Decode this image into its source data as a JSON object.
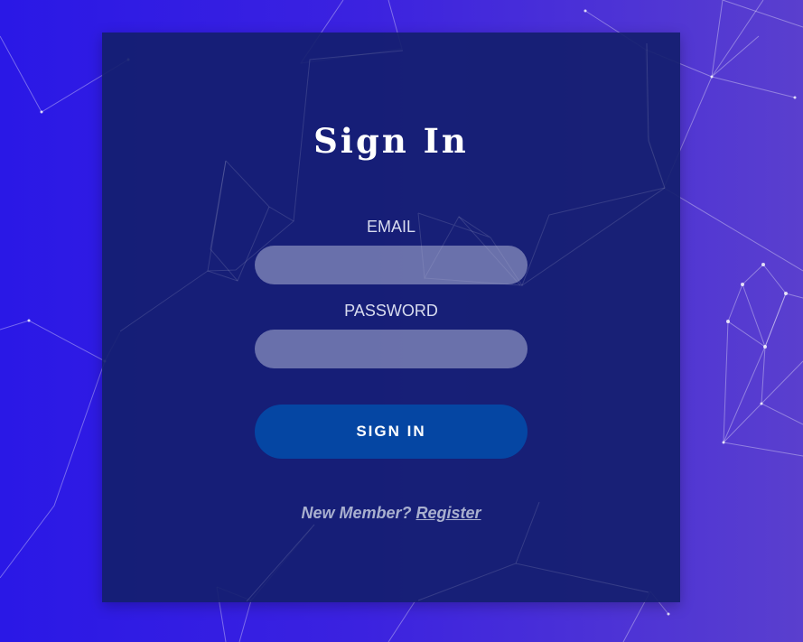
{
  "form": {
    "title": "Sign In",
    "email_label": "EMAIL",
    "email_value": "",
    "password_label": "PASSWORD",
    "password_value": "",
    "submit_label": "SIGN IN",
    "register_prompt": "New Member?",
    "register_link": "Register"
  },
  "colors": {
    "background_start": "#2a18e6",
    "background_end": "#5a3fce",
    "card": "#141e6e",
    "input": "#afb4d7",
    "button": "#0546a3",
    "text": "#ffffff",
    "muted_text": "#a9b0cf"
  }
}
